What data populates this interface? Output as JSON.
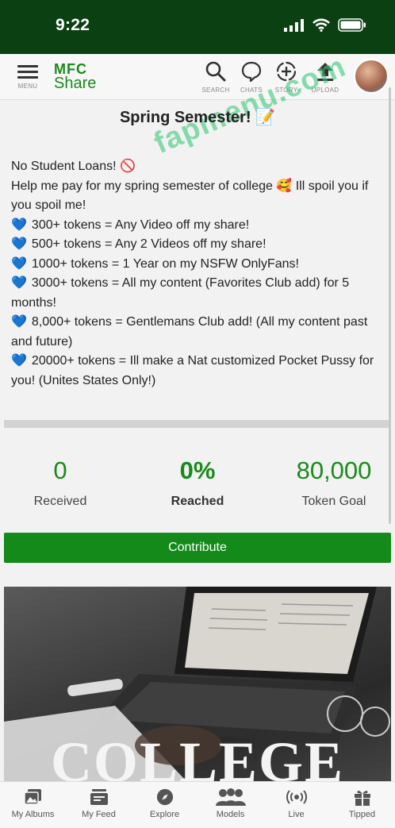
{
  "status_bar": {
    "time": "9:22"
  },
  "header": {
    "menu_label": "MENU",
    "logo_top": "MFC",
    "logo_bottom": "Share",
    "search_label": "SEARCH",
    "chats_label": "CHATS",
    "story_label": "STORY",
    "upload_label": "UPLOAD"
  },
  "watermark": "fapmenu.com",
  "goal": {
    "title": "Spring Semester! 📝",
    "description": [
      "No Student Loans! 🚫",
      "Help me pay for my spring semester of college 🥰 Ill spoil you if you spoil me!",
      "300+ tokens = Any Video off my share!",
      "500+ tokens = Any 2 Videos off my share!",
      "1000+ tokens = 1 Year on my NSFW OnlyFans!",
      "3000+ tokens = All my content (Favorites Club add) for 5 months!",
      "8,000+ tokens = Gentlemans Club add! (All my content past and future)",
      "20000+ tokens = Ill make a Nat customized Pocket Pussy for you! (Unites States Only!)"
    ],
    "heart_icon": "💙",
    "progress": 0,
    "received_value": "0",
    "received_label": "Received",
    "reached_value": "0%",
    "reached_label": "Reached",
    "goal_value": "80,000",
    "goal_label": "Token Goal",
    "contribute_label": "Contribute",
    "cover_text": "COLLEGE"
  },
  "bottom_nav": [
    {
      "label": "My Albums",
      "icon": "albums-icon"
    },
    {
      "label": "My Feed",
      "icon": "feed-icon"
    },
    {
      "label": "Explore",
      "icon": "compass-icon"
    },
    {
      "label": "Models",
      "icon": "models-icon"
    },
    {
      "label": "Live",
      "icon": "live-icon"
    },
    {
      "label": "Tipped",
      "icon": "gift-icon"
    }
  ],
  "colors": {
    "brand_green": "#1a8a1a",
    "status_bar": "#0b4012",
    "heart": "#5ec8e8"
  }
}
